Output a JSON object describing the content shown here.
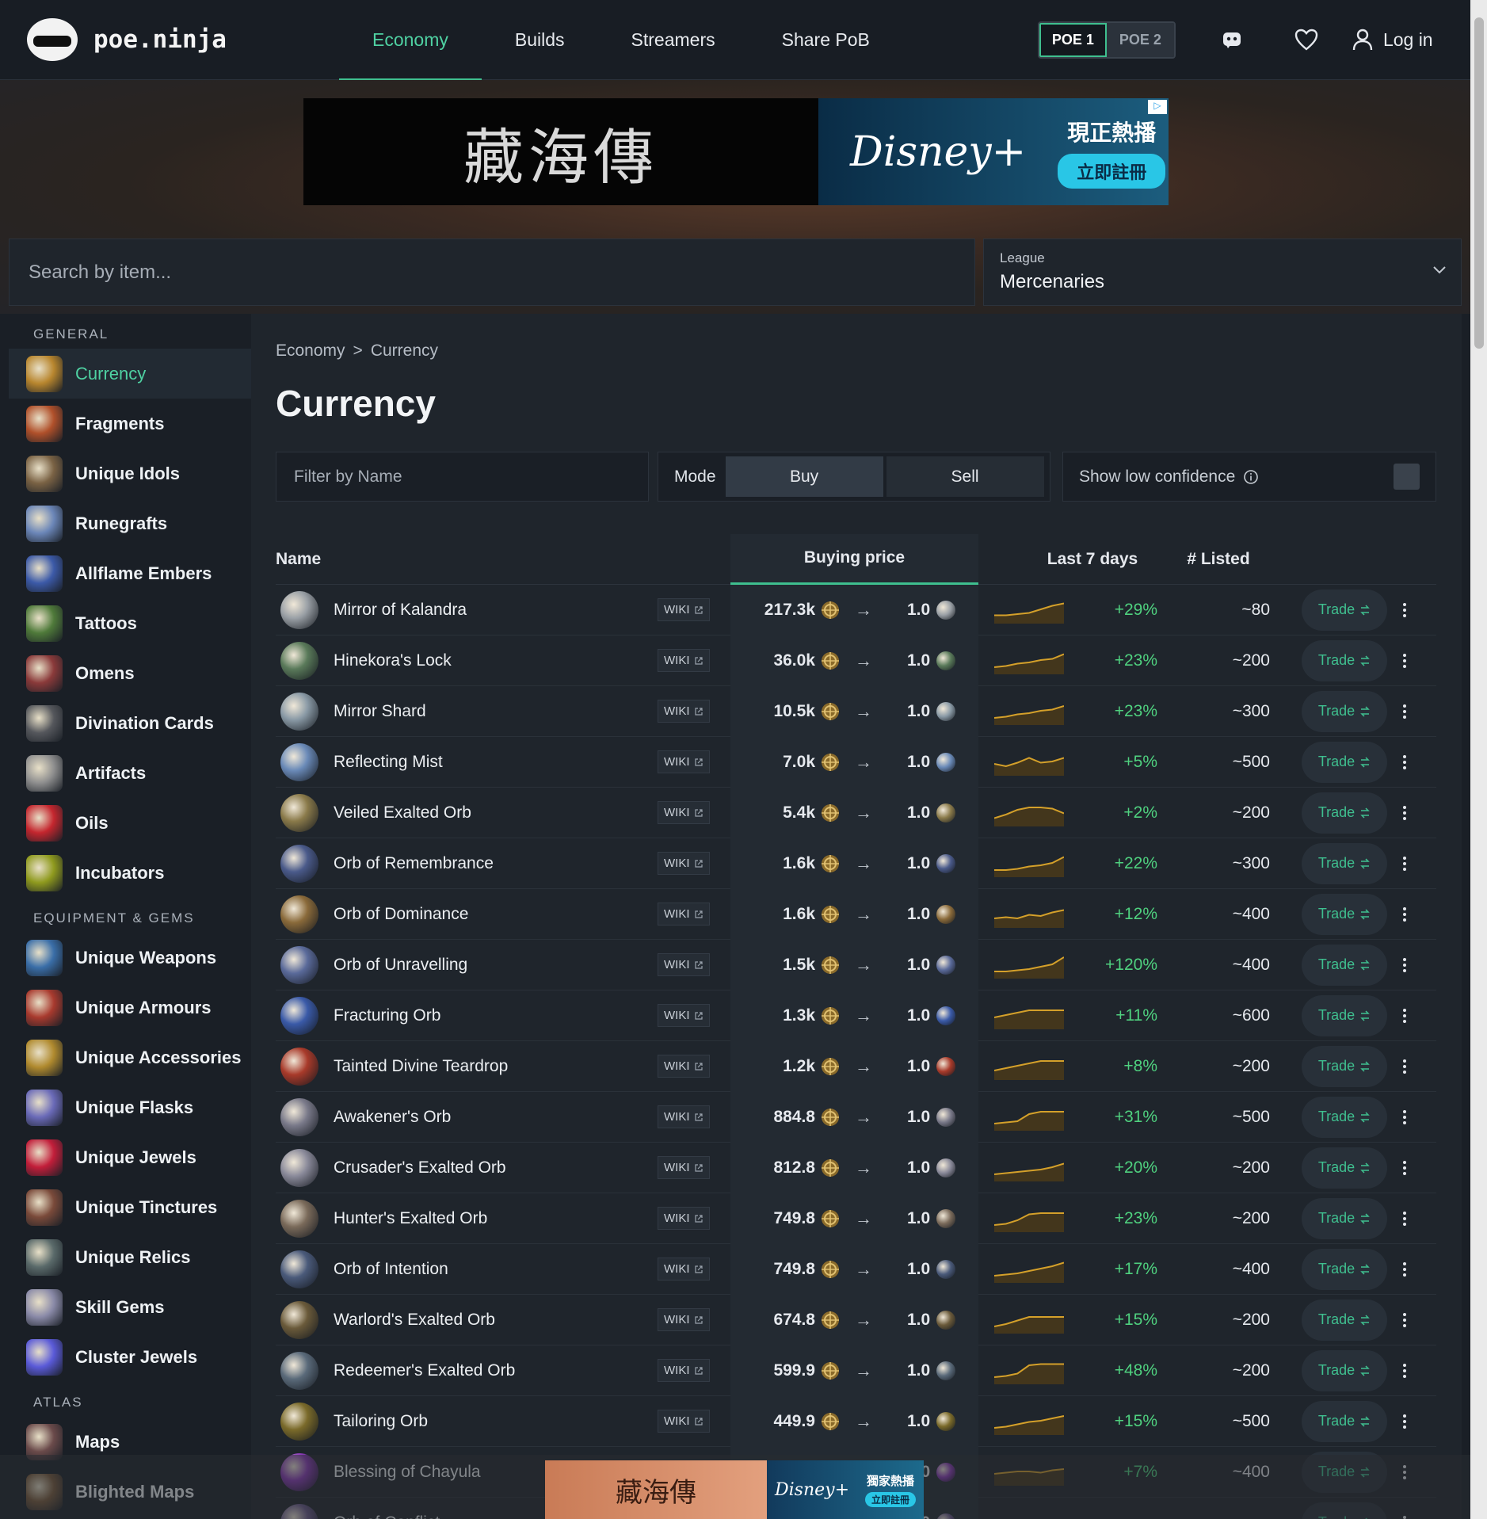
{
  "header": {
    "logo_text": "poe.ninja",
    "nav": [
      {
        "label": "Economy",
        "active": true
      },
      {
        "label": "Builds",
        "active": false
      },
      {
        "label": "Streamers",
        "active": false
      },
      {
        "label": "Share PoB",
        "active": false
      }
    ],
    "poe_toggle": [
      "POE 1",
      "POE 2"
    ],
    "login_label": "Log in",
    "icons": [
      "discord-icon",
      "heart-icon",
      "user-icon"
    ]
  },
  "ad_top": {
    "left_text": "藏海傳",
    "brand": "Disney+",
    "slogan": "現正熱播",
    "cta": "立即註冊"
  },
  "search": {
    "placeholder": "Search by item..."
  },
  "league": {
    "label": "League",
    "value": "Mercenaries"
  },
  "sidebar": {
    "sections": [
      {
        "title": "GENERAL",
        "items": [
          {
            "label": "Currency",
            "active": true,
            "color": "#b8862e"
          },
          {
            "label": "Fragments",
            "color": "#b0502a"
          },
          {
            "label": "Unique Idols",
            "color": "#7a6244"
          },
          {
            "label": "Runegrafts",
            "color": "#6b86b8"
          },
          {
            "label": "Allflame Embers",
            "color": "#3c5aa8"
          },
          {
            "label": "Tattoos",
            "color": "#4f7a3a"
          },
          {
            "label": "Omens",
            "color": "#8a3a3a"
          },
          {
            "label": "Divination Cards",
            "color": "#55575c"
          },
          {
            "label": "Artifacts",
            "color": "#8f8f8f"
          },
          {
            "label": "Oils",
            "color": "#c4262e"
          },
          {
            "label": "Incubators",
            "color": "#8f9a1e"
          }
        ]
      },
      {
        "title": "EQUIPMENT & GEMS",
        "items": [
          {
            "label": "Unique Weapons",
            "color": "#3a6ea8"
          },
          {
            "label": "Unique Armours",
            "color": "#a83a2e"
          },
          {
            "label": "Unique Accessories",
            "color": "#b08a2e"
          },
          {
            "label": "Unique Flasks",
            "color": "#6a6ab8"
          },
          {
            "label": "Unique Jewels",
            "color": "#c21e3a"
          },
          {
            "label": "Unique Tinctures",
            "color": "#7a4a3a"
          },
          {
            "label": "Unique Relics",
            "color": "#5a6a6a"
          },
          {
            "label": "Skill Gems",
            "color": "#8a8aa8"
          },
          {
            "label": "Cluster Jewels",
            "color": "#5a5ad8"
          }
        ]
      },
      {
        "title": "ATLAS",
        "items": [
          {
            "label": "Maps",
            "color": "#6a4a4a"
          },
          {
            "label": "Blighted Maps",
            "color": "#7a5a3a"
          }
        ]
      }
    ]
  },
  "main": {
    "breadcrumb": [
      "Economy",
      ">",
      "Currency"
    ],
    "title": "Currency",
    "filter_placeholder": "Filter by Name",
    "mode_label": "Mode",
    "mode_buy": "Buy",
    "mode_sell": "Sell",
    "low_conf_label": "Show low confidence",
    "columns": {
      "name": "Name",
      "buying_price": "Buying price",
      "last7": "Last 7 days",
      "listed": "# Listed"
    },
    "wiki_label": "WIKI",
    "trade_label": "Trade",
    "one_label": "1.0",
    "arrow": "→"
  },
  "rows": [
    {
      "name": "Mirror of Kalandra",
      "price": "217.3k",
      "change": "+29%",
      "listed": "~80",
      "icon_color": "#9aa0a6",
      "spark": [
        0.35,
        0.35,
        0.4,
        0.45,
        0.6,
        0.75,
        0.85
      ]
    },
    {
      "name": "Hinekora's Lock",
      "price": "36.0k",
      "change": "+23%",
      "listed": "~200",
      "icon_color": "#5a7a5a",
      "spark": [
        0.3,
        0.35,
        0.45,
        0.5,
        0.6,
        0.65,
        0.85
      ]
    },
    {
      "name": "Mirror Shard",
      "price": "10.5k",
      "change": "+23%",
      "listed": "~300",
      "icon_color": "#8a9aa6",
      "spark": [
        0.3,
        0.35,
        0.45,
        0.5,
        0.6,
        0.65,
        0.8
      ]
    },
    {
      "name": "Reflecting Mist",
      "price": "7.0k",
      "change": "+5%",
      "listed": "~500",
      "icon_color": "#6a8ab8",
      "spark": [
        0.5,
        0.4,
        0.55,
        0.75,
        0.55,
        0.6,
        0.75
      ]
    },
    {
      "name": "Veiled Exalted Orb",
      "price": "5.4k",
      "change": "+2%",
      "listed": "~200",
      "icon_color": "#8a7a4a",
      "spark": [
        0.35,
        0.5,
        0.7,
        0.8,
        0.8,
        0.75,
        0.55
      ]
    },
    {
      "name": "Orb of Remembrance",
      "price": "1.6k",
      "change": "+22%",
      "listed": "~300",
      "icon_color": "#4a5a8a",
      "spark": [
        0.3,
        0.3,
        0.35,
        0.45,
        0.5,
        0.6,
        0.85
      ]
    },
    {
      "name": "Orb of Dominance",
      "price": "1.6k",
      "change": "+12%",
      "listed": "~400",
      "icon_color": "#8a6a3a",
      "spark": [
        0.4,
        0.45,
        0.4,
        0.55,
        0.5,
        0.65,
        0.75
      ]
    },
    {
      "name": "Orb of Unravelling",
      "price": "1.5k",
      "change": "+120%",
      "listed": "~400",
      "icon_color": "#5a6a9a",
      "spark": [
        0.3,
        0.3,
        0.35,
        0.4,
        0.5,
        0.6,
        0.9
      ]
    },
    {
      "name": "Fracturing Orb",
      "price": "1.3k",
      "change": "+11%",
      "listed": "~600",
      "icon_color": "#3a5aa8",
      "spark": [
        0.5,
        0.6,
        0.7,
        0.8,
        0.8,
        0.8,
        0.8
      ]
    },
    {
      "name": "Tainted Divine Teardrop",
      "price": "1.2k",
      "change": "+8%",
      "listed": "~200",
      "icon_color": "#a83a2a",
      "spark": [
        0.4,
        0.5,
        0.6,
        0.7,
        0.8,
        0.8,
        0.8
      ]
    },
    {
      "name": "Awakener's Orb",
      "price": "884.8",
      "change": "+31%",
      "listed": "~500",
      "icon_color": "#7a7a8a",
      "spark": [
        0.3,
        0.35,
        0.4,
        0.7,
        0.8,
        0.8,
        0.8
      ]
    },
    {
      "name": "Crusader's Exalted Orb",
      "price": "812.8",
      "change": "+20%",
      "listed": "~200",
      "icon_color": "#8a8a9a",
      "spark": [
        0.3,
        0.35,
        0.4,
        0.45,
        0.5,
        0.6,
        0.75
      ]
    },
    {
      "name": "Hunter's Exalted Orb",
      "price": "749.8",
      "change": "+23%",
      "listed": "~200",
      "icon_color": "#7a6a5a",
      "spark": [
        0.3,
        0.35,
        0.5,
        0.75,
        0.8,
        0.8,
        0.8
      ]
    },
    {
      "name": "Orb of Intention",
      "price": "749.8",
      "change": "+17%",
      "listed": "~400",
      "icon_color": "#4a5a7a",
      "spark": [
        0.3,
        0.35,
        0.4,
        0.5,
        0.6,
        0.7,
        0.85
      ]
    },
    {
      "name": "Warlord's Exalted Orb",
      "price": "674.8",
      "change": "+15%",
      "listed": "~200",
      "icon_color": "#6a5a3a",
      "spark": [
        0.3,
        0.4,
        0.55,
        0.7,
        0.7,
        0.7,
        0.7
      ]
    },
    {
      "name": "Redeemer's Exalted Orb",
      "price": "599.9",
      "change": "+48%",
      "listed": "~200",
      "icon_color": "#5a6a7a",
      "spark": [
        0.3,
        0.35,
        0.45,
        0.8,
        0.85,
        0.85,
        0.85
      ]
    },
    {
      "name": "Tailoring Orb",
      "price": "449.9",
      "change": "+15%",
      "listed": "~500",
      "icon_color": "#7a6a2a",
      "spark": [
        0.3,
        0.35,
        0.45,
        0.55,
        0.6,
        0.7,
        0.8
      ]
    },
    {
      "name": "Blessing of Chayula",
      "price": "",
      "change": "+7%",
      "listed": "~400",
      "icon_color": "#8a3ab8",
      "spark": [
        0.5,
        0.55,
        0.6,
        0.6,
        0.55,
        0.65,
        0.7
      ]
    },
    {
      "name": "Orb of Conflict",
      "price": "",
      "change": "",
      "listed": "",
      "icon_color": "#6a5a8a",
      "spark": [
        0.4,
        0.45,
        0.5,
        0.55,
        0.6,
        0.65,
        0.7
      ]
    }
  ],
  "ad_bottom": {
    "left_text": "藏海傳",
    "brand": "Disney+",
    "slogan": "獨家熱播",
    "cta": "立即註冊"
  }
}
